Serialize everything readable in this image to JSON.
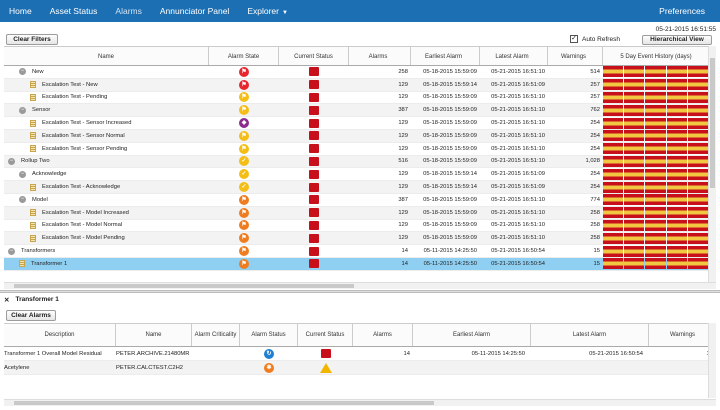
{
  "nav": {
    "items": [
      "Home",
      "Asset Status",
      "Alarms",
      "Annunciator Panel",
      "Explorer"
    ],
    "active": "Alarms",
    "preferences": "Preferences"
  },
  "timestamp": "05-21-2015 16:51:55",
  "toolbar": {
    "clear_filters": "Clear Filters",
    "auto_refresh": "Auto Refresh",
    "auto_refresh_checked": true,
    "view": "Hierarchical View"
  },
  "columns": [
    "Name",
    "Alarm State",
    "Current Status",
    "Alarms",
    "Earliest Alarm",
    "Latest Alarm",
    "Warnings",
    "5 Day Event History (days)"
  ],
  "rows": [
    {
      "name": "New",
      "level": 1,
      "type": "group",
      "state": "red",
      "status": "red",
      "alarms": "258",
      "earliest": "05-18-2015 15:59:09",
      "latest": "05-21-2015 16:51:10",
      "warnings": "514"
    },
    {
      "name": "Escalation Test - New",
      "level": 2,
      "type": "leaf",
      "state": "red",
      "status": "red",
      "alarms": "129",
      "earliest": "05-18-2015 15:59:14",
      "latest": "05-21-2015 16:51:09",
      "warnings": "257"
    },
    {
      "name": "Escalation Test - Pending",
      "level": 2,
      "type": "leaf",
      "state": "yellow",
      "status": "red",
      "alarms": "129",
      "earliest": "05-18-2015 15:59:09",
      "latest": "05-21-2015 16:51:10",
      "warnings": "257"
    },
    {
      "name": "Sensor",
      "level": 1,
      "type": "group",
      "state": "yellow",
      "status": "red",
      "alarms": "387",
      "earliest": "05-18-2015 15:59:09",
      "latest": "05-21-2015 16:51:10",
      "warnings": "762"
    },
    {
      "name": "Escalation Test - Sensor Increased",
      "level": 2,
      "type": "leaf",
      "state": "purple",
      "status": "red",
      "alarms": "129",
      "earliest": "05-18-2015 15:59:09",
      "latest": "05-21-2015 16:51:10",
      "warnings": "254"
    },
    {
      "name": "Escalation Test - Sensor Normal",
      "level": 2,
      "type": "leaf",
      "state": "yellow",
      "status": "red",
      "alarms": "129",
      "earliest": "05-18-2015 15:59:09",
      "latest": "05-21-2015 16:51:10",
      "warnings": "254"
    },
    {
      "name": "Escalation Test - Sensor Pending",
      "level": 2,
      "type": "leaf",
      "state": "yellow",
      "status": "red",
      "alarms": "129",
      "earliest": "05-18-2015 15:59:09",
      "latest": "05-21-2015 16:51:10",
      "warnings": "254"
    },
    {
      "name": "Rollup Two",
      "level": 0,
      "type": "group",
      "state": "yellowcheck",
      "status": "red",
      "alarms": "516",
      "earliest": "05-18-2015 15:59:09",
      "latest": "05-21-2015 16:51:10",
      "warnings": "1,028"
    },
    {
      "name": "Acknowledge",
      "level": 1,
      "type": "group",
      "state": "yellowcheck",
      "status": "red",
      "alarms": "129",
      "earliest": "05-18-2015 15:59:14",
      "latest": "05-21-2015 16:51:09",
      "warnings": "254"
    },
    {
      "name": "Escalation Test - Acknowledge",
      "level": 2,
      "type": "leaf",
      "state": "yellowcheck",
      "status": "red",
      "alarms": "129",
      "earliest": "05-18-2015 15:59:14",
      "latest": "05-21-2015 16:51:09",
      "warnings": "254"
    },
    {
      "name": "Model",
      "level": 1,
      "type": "group",
      "state": "orange",
      "status": "red",
      "alarms": "387",
      "earliest": "05-18-2015 15:59:09",
      "latest": "05-21-2015 16:51:10",
      "warnings": "774"
    },
    {
      "name": "Escalation Test - Model Increased",
      "level": 2,
      "type": "leaf",
      "state": "orange",
      "status": "red",
      "alarms": "129",
      "earliest": "05-18-2015 15:59:09",
      "latest": "05-21-2015 16:51:10",
      "warnings": "258"
    },
    {
      "name": "Escalation Test - Model Normal",
      "level": 2,
      "type": "leaf",
      "state": "orange",
      "status": "red",
      "alarms": "129",
      "earliest": "05-18-2015 15:59:09",
      "latest": "05-21-2015 16:51:10",
      "warnings": "258"
    },
    {
      "name": "Escalation Test - Model Pending",
      "level": 2,
      "type": "leaf",
      "state": "orange",
      "status": "red",
      "alarms": "129",
      "earliest": "05-18-2015 15:59:09",
      "latest": "05-21-2015 16:51:10",
      "warnings": "258"
    },
    {
      "name": "Transformers",
      "level": 0,
      "type": "group",
      "state": "orange",
      "status": "red",
      "alarms": "14",
      "earliest": "05-11-2015 14:25:50",
      "latest": "05-21-2015 16:50:54",
      "warnings": "15"
    },
    {
      "name": "Transformer 1",
      "level": 1,
      "type": "leaf",
      "state": "orange",
      "status": "red",
      "alarms": "14",
      "earliest": "05-11-2015 14:25:50",
      "latest": "05-21-2015 16:50:54",
      "warnings": "15",
      "selected": true
    }
  ],
  "history_colors": {
    "red": "#c8101d",
    "yellow": "#f1c640"
  },
  "detail": {
    "title": "Transformer 1",
    "clear_alarms": "Clear Alarms",
    "columns": [
      "Description",
      "Name",
      "Alarm Criticality",
      "Alarm Status",
      "Current Status",
      "Alarms",
      "Earliest Alarm",
      "Latest Alarm",
      "Warnings"
    ],
    "rows": [
      {
        "description": "Transformer 1 Overall Model Residual",
        "name": "PETER.ARCHIVE.21480MR",
        "criticality": "",
        "status_icon": "blue",
        "current": "square",
        "alarms": "14",
        "earliest": "05-11-2015 14:25:50",
        "latest": "05-21-2015 16:50:54",
        "warnings": "14"
      },
      {
        "description": "Acetylene",
        "name": "PETER.CALCTEST.C2H2",
        "criticality": "",
        "status_icon": "orange",
        "current": "triangle",
        "alarms": "",
        "earliest": "",
        "latest": "",
        "warnings": "1"
      }
    ]
  }
}
